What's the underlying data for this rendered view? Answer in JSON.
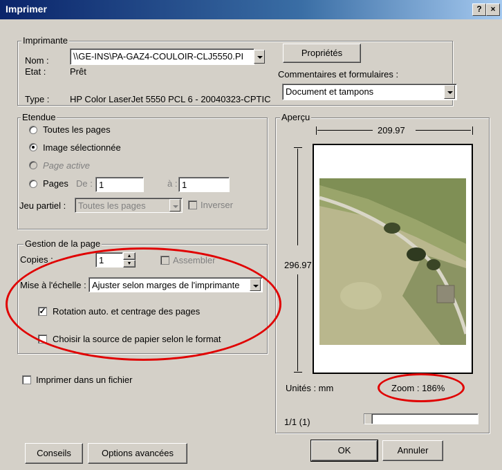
{
  "window": {
    "title": "Imprimer",
    "help_glyph": "?",
    "close_glyph": "×"
  },
  "printer": {
    "legend": "Imprimante",
    "name_label": "Nom :",
    "name_value": "\\\\GE-INS\\PA-GAZ4-COULOIR-CLJ5550.PI",
    "status_label": "Etat :",
    "status_value": "Prêt",
    "type_label": "Type :",
    "type_value": "HP Color LaserJet 5550 PCL 6 - 20040323-CPTIC",
    "properties_button": "Propriétés",
    "comments_label": "Commentaires et formulaires :",
    "comments_value": "Document et tampons"
  },
  "range": {
    "legend": "Etendue",
    "all_pages": "Toutes les pages",
    "selected_image": "Image sélectionnée",
    "active_page": "Page active",
    "pages": "Pages",
    "from_label": "De :",
    "from_value": "1",
    "to_label": "à :",
    "to_value": "1",
    "subset_label": "Jeu partiel :",
    "subset_value": "Toutes les pages",
    "reverse_label": "Inverser"
  },
  "page_handling": {
    "legend": "Gestion de la page",
    "copies_label": "Copies :",
    "copies_value": "1",
    "collate_label": "Assembler",
    "scaling_label": "Mise à l'échelle :",
    "scaling_value": "Ajuster selon marges de l'imprimante",
    "auto_rotate_label": "Rotation auto. et centrage des pages",
    "auto_rotate_checked": true,
    "paper_source_label": "Choisir la source de papier selon le format",
    "paper_source_checked": false
  },
  "print_to_file_label": "Imprimer dans un fichier",
  "preview": {
    "legend": "Aperçu",
    "width_value": "209.97",
    "height_value": "296.97",
    "units_label": "Unités : mm",
    "zoom_label": "Zoom : 186%",
    "page_counter": "1/1 (1)",
    "slider_level": 0.0
  },
  "buttons": {
    "tips": "Conseils",
    "advanced": "Options avancées",
    "ok": "OK",
    "cancel": "Annuler"
  },
  "colors": {
    "annotation": "#e00000",
    "face": "#d4d0c8"
  }
}
